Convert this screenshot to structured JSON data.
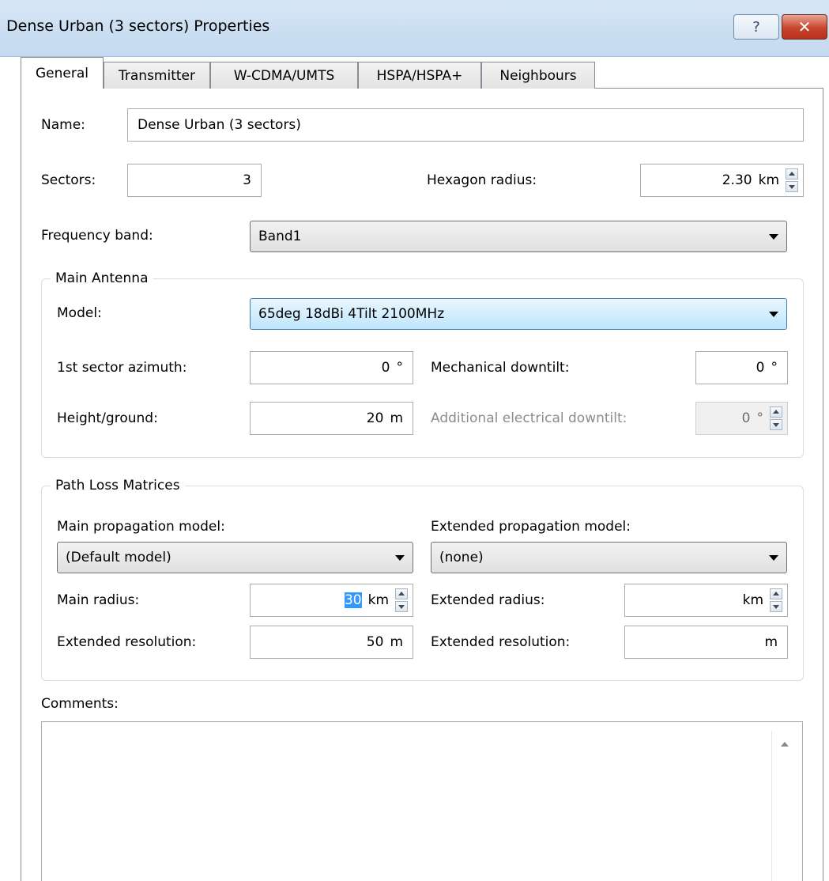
{
  "window": {
    "title": "Dense Urban (3 sectors) Properties",
    "help_symbol": "?",
    "close_symbol": "✕"
  },
  "tabs": [
    {
      "label": "General",
      "active": true
    },
    {
      "label": "Transmitter"
    },
    {
      "label": "W-CDMA/UMTS"
    },
    {
      "label": "HSPA/HSPA+"
    },
    {
      "label": "Neighbours"
    }
  ],
  "general": {
    "name_label": "Name:",
    "name_value": "Dense Urban (3 sectors)",
    "sectors_label": "Sectors:",
    "sectors_value": "3",
    "hexagon_label": "Hexagon radius:",
    "hexagon_value": "2.30",
    "hexagon_unit": "km",
    "freq_label": "Frequency band:",
    "freq_value": "Band1"
  },
  "main_antenna": {
    "group_label": "Main Antenna",
    "model_label": "Model:",
    "model_value": "65deg 18dBi 4Tilt 2100MHz",
    "azimuth_label": "1st sector azimuth:",
    "azimuth_value": "0",
    "azimuth_unit": "°",
    "mech_label": "Mechanical downtilt:",
    "mech_value": "0",
    "mech_unit": "°",
    "height_label": "Height/ground:",
    "height_value": "20",
    "height_unit": "m",
    "elec_label": "Additional electrical downtilt:",
    "elec_value": "0",
    "elec_unit": "°"
  },
  "path_loss": {
    "group_label": "Path Loss Matrices",
    "main_model_label": "Main propagation model:",
    "main_model_value": "(Default model)",
    "ext_model_label": "Extended propagation model:",
    "ext_model_value": "(none)",
    "main_radius_label": "Main radius:",
    "main_radius_value": "30",
    "main_radius_unit": "km",
    "ext_radius_label": "Extended radius:",
    "ext_radius_value": "",
    "ext_radius_unit": "km",
    "main_res_label": "Extended resolution:",
    "main_res_value": "50",
    "main_res_unit": "m",
    "ext_res_label": "Extended resolution:",
    "ext_res_value": "",
    "ext_res_unit": "m"
  },
  "comments": {
    "label": "Comments:",
    "value": ""
  }
}
